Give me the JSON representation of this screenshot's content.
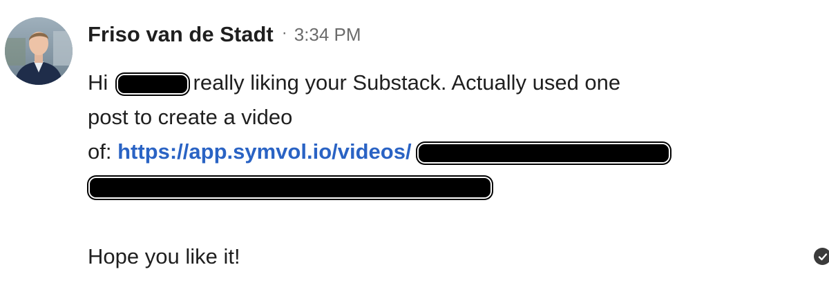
{
  "sender": {
    "name": "Friso van de Stadt",
    "separator": "·",
    "time": "3:34 PM",
    "avatar_icon": "profile-photo"
  },
  "message": {
    "line1_start": "Hi",
    "line1_end": " really liking your Substack. Actually used one",
    "line2": "post to create a video",
    "line3_prefix": "of: ",
    "link_text": "https://app.symvol.io/videos/",
    "line5": "Hope you like it!"
  },
  "status": {
    "icon": "check-circle-icon"
  },
  "colors": {
    "link": "#2a63c4",
    "text": "#1f1f1f",
    "muted": "#6b6b6b",
    "redaction": "#000000"
  }
}
